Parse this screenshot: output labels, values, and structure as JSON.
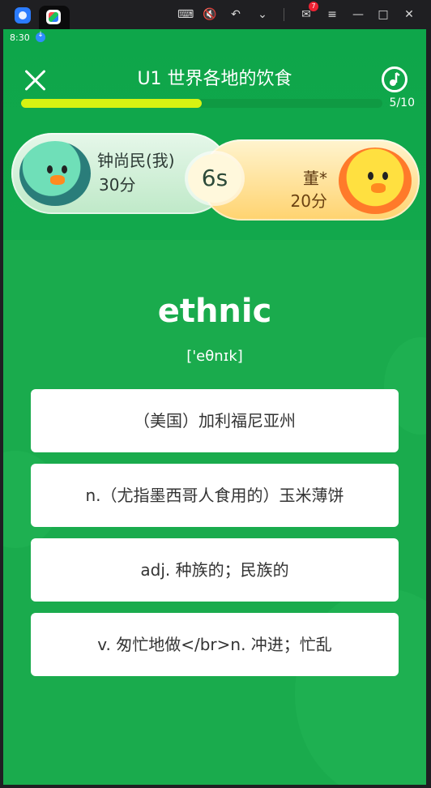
{
  "topbar": {
    "mail_badge_count": "7",
    "icons": [
      "keyboard-icon",
      "mute-icon",
      "undo-icon",
      "chevron-down-icon",
      "mail-icon",
      "menu-icon",
      "minimize-icon",
      "maximize-icon",
      "close-icon"
    ]
  },
  "status": {
    "time": "8:30"
  },
  "header": {
    "title": "U1 世界各地的饮食",
    "progress_text": "5/10",
    "progress_fraction": 0.5
  },
  "match": {
    "player1": {
      "name": "钟尚民(我)",
      "score": "30分"
    },
    "timer": "6s",
    "player2": {
      "name": "董*",
      "score": "20分"
    }
  },
  "question": {
    "word": "ethnic",
    "phonetic": "['eθnɪk]"
  },
  "options": [
    "（美国）加利福尼亚州",
    "n.（尤指墨西哥人食用的）玉米薄饼",
    "adj. 种族的；民族的",
    "v. 匆忙地做</br>n. 冲进；忙乱"
  ],
  "colors": {
    "background_green": "#1aab4d",
    "progress_fill": "#d7f212",
    "card_left": "#d9f3df",
    "card_right": "#ffe08a"
  }
}
